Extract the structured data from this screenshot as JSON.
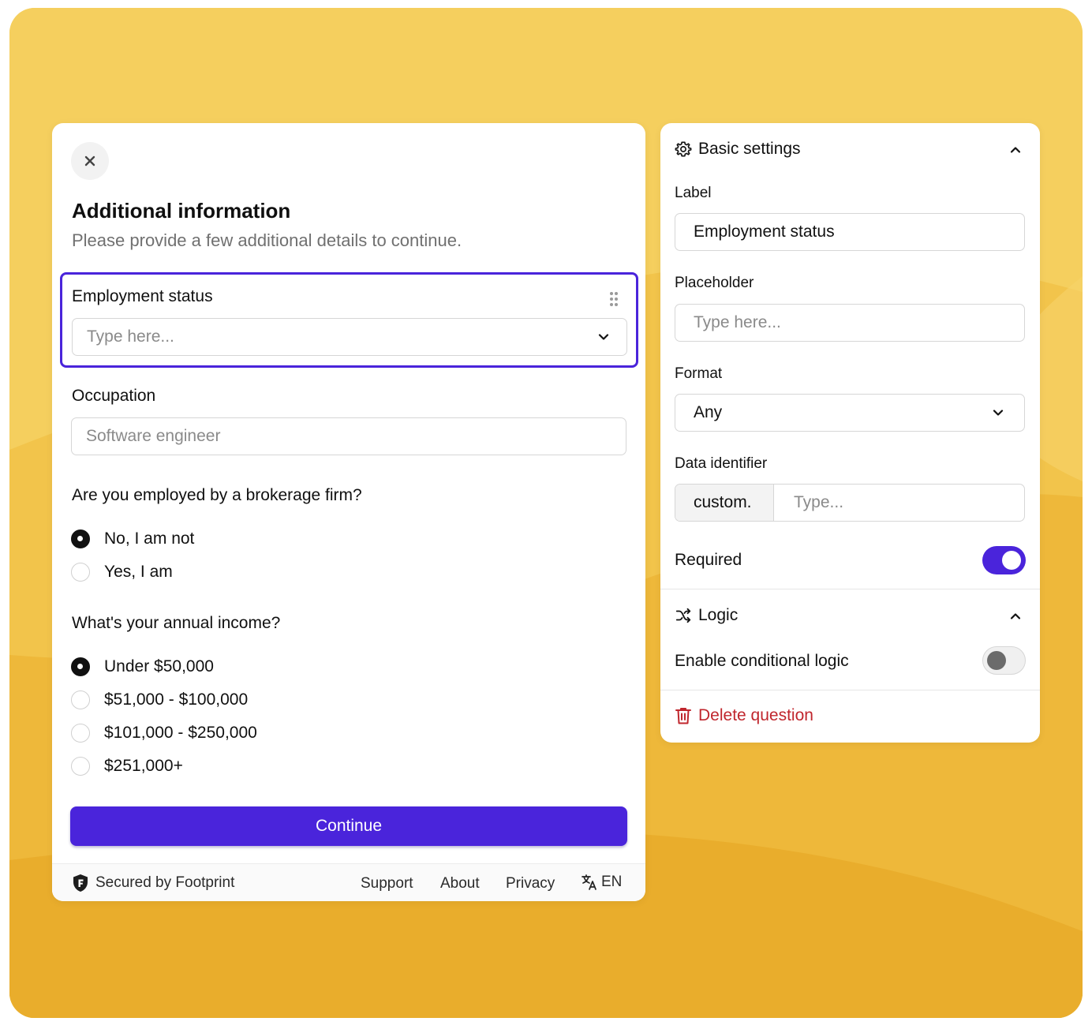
{
  "form": {
    "title": "Additional information",
    "subtitle": "Please provide a few additional details to continue.",
    "employment": {
      "label": "Employment status",
      "placeholder": "Type here..."
    },
    "occupation": {
      "label": "Occupation",
      "placeholder": "Software engineer"
    },
    "brokerage": {
      "question": "Are you employed by a brokerage firm?",
      "options": [
        {
          "label": "No, I am not",
          "selected": true
        },
        {
          "label": "Yes, I am",
          "selected": false
        }
      ]
    },
    "income": {
      "question": "What's your annual income?",
      "options": [
        {
          "label": "Under $50,000",
          "selected": true
        },
        {
          "label": "$51,000 - $100,000",
          "selected": false
        },
        {
          "label": "$101,000 - $250,000",
          "selected": false
        },
        {
          "label": "$251,000+",
          "selected": false
        }
      ]
    },
    "continue_label": "Continue",
    "footer": {
      "secured": "Secured by Footprint",
      "support": "Support",
      "about": "About",
      "privacy": "Privacy",
      "language": "EN"
    }
  },
  "settings": {
    "basic_title": "Basic settings",
    "label_title": "Label",
    "label_value": "Employment status",
    "placeholder_title": "Placeholder",
    "placeholder_value": "Type here...",
    "format_title": "Format",
    "format_value": "Any",
    "identifier_title": "Data identifier",
    "identifier_prefix": "custom.",
    "identifier_placeholder": "Type...",
    "required_label": "Required",
    "required_on": true,
    "logic_title": "Logic",
    "conditional_label": "Enable conditional logic",
    "conditional_on": false,
    "delete_label": "Delete question"
  },
  "colors": {
    "accent": "#4a24db",
    "danger": "#c0262d",
    "background": "#f3c64c"
  }
}
